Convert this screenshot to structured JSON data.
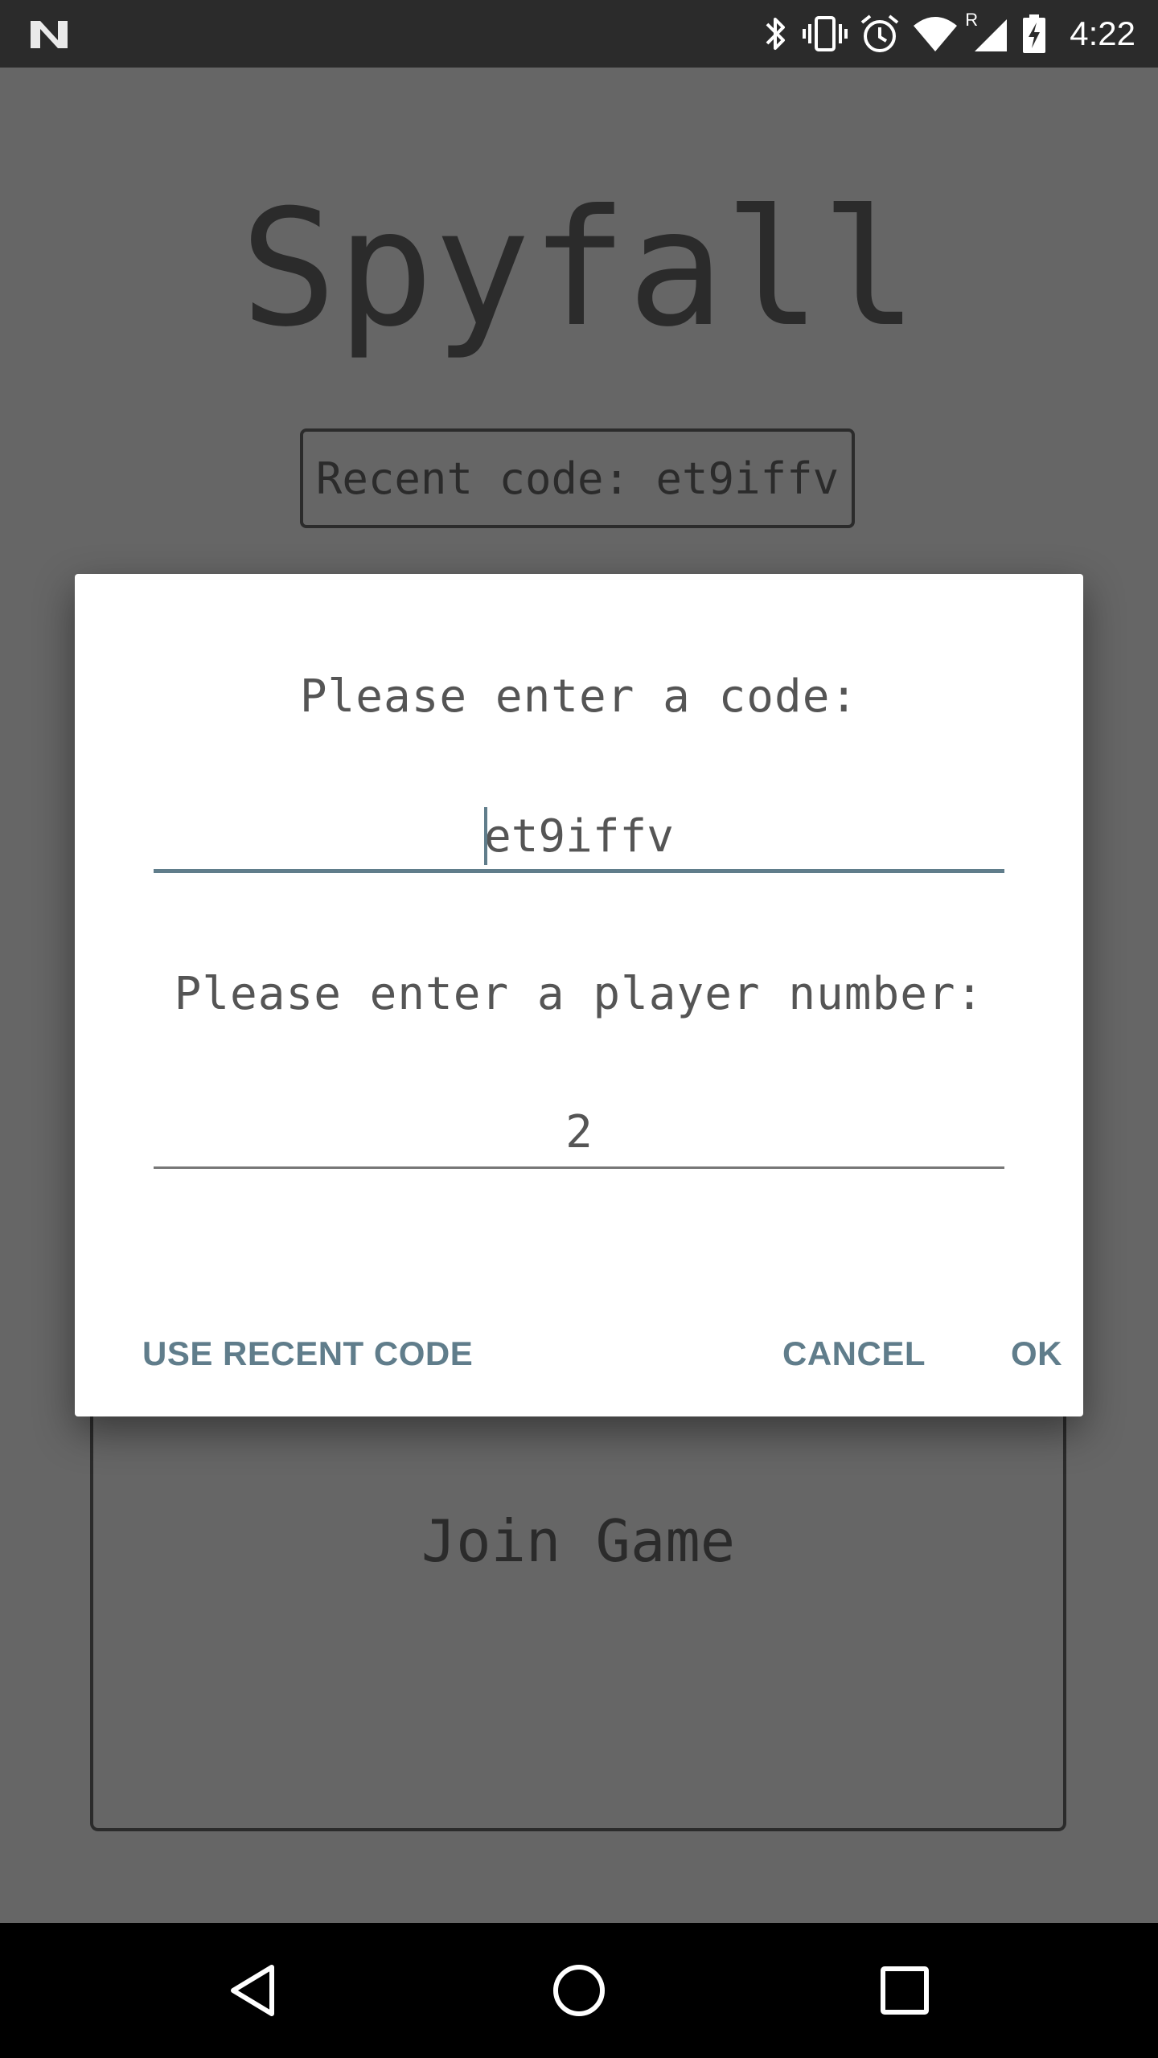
{
  "status_bar": {
    "time": "4:22",
    "icons": [
      "n-logo-icon",
      "bluetooth-icon",
      "vibrate-icon",
      "alarm-icon",
      "wifi-icon",
      "signal-roaming-icon",
      "battery-charging-icon"
    ],
    "roaming_indicator": "R"
  },
  "app": {
    "title": "Spyfall",
    "recent_code_label": "Recent code: et9iffv",
    "join_game_label": "Join Game"
  },
  "dialog": {
    "code_prompt": "Please enter a code:",
    "code_value": "et9iffv",
    "player_prompt": "Please enter a player number:",
    "player_value": "2",
    "buttons": {
      "use_recent": "USE RECENT CODE",
      "cancel": "CANCEL",
      "ok": "OK"
    },
    "accent_color": "#607d8b"
  },
  "nav_bar": {
    "icons": [
      "back-icon",
      "home-icon",
      "recents-icon"
    ]
  }
}
